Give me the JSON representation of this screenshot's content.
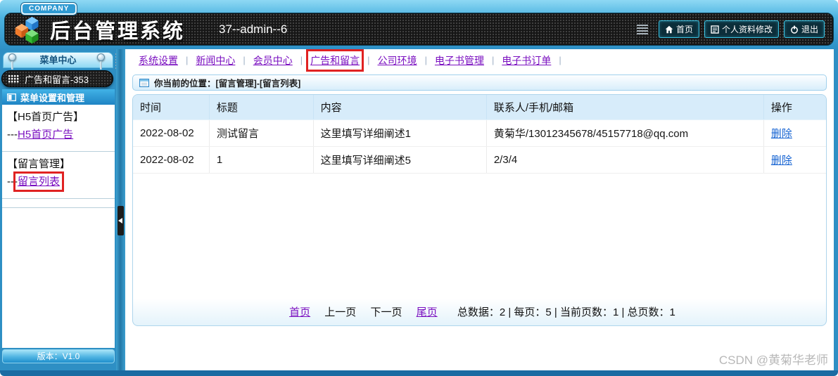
{
  "header": {
    "company_badge": "COMPANY",
    "app_title": "后台管理系统",
    "session_info": "37--admin--6",
    "nav_buttons": [
      {
        "label": "首页"
      },
      {
        "label": "个人资料修改"
      },
      {
        "label": "退出"
      }
    ]
  },
  "sidebar": {
    "menu_center_title": "菜单中心",
    "module_pill_label": "广告和留言-353",
    "section_title": "菜单设置和管理",
    "groups": [
      {
        "heading": "【H5首页广告】",
        "link_prefix": "---",
        "link_label": "H5首页广告"
      },
      {
        "heading": "【留言管理】",
        "link_prefix": "---",
        "link_label": "留言列表"
      }
    ],
    "version_label": "版本：V1.0"
  },
  "topnav": {
    "separator": "|",
    "items": [
      {
        "label": "系统设置"
      },
      {
        "label": "新闻中心"
      },
      {
        "label": "会员中心"
      },
      {
        "label": "广告和留言"
      },
      {
        "label": "公司环境"
      },
      {
        "label": "电子书管理"
      },
      {
        "label": "电子书订单"
      }
    ]
  },
  "breadcrumb": {
    "text": "你当前的位置：[留言管理]-[留言列表]"
  },
  "table": {
    "columns": [
      "时间",
      "标题",
      "内容",
      "联系人/手机/邮箱",
      "操作"
    ],
    "rows": [
      {
        "time": "2022-08-02",
        "title": "测试留言",
        "content": "这里填写详细阐述1",
        "contact": "黄菊华/13012345678/45157718@qq.com",
        "action": "删除"
      },
      {
        "time": "2022-08-02",
        "title": "1",
        "content": "这里填写详细阐述5",
        "contact": "2/3/4",
        "action": "删除"
      }
    ]
  },
  "pagination": {
    "first": "首页",
    "prev": "上一页",
    "next": "下一页",
    "last": "尾页",
    "summary": "总数据：2 | 每页：5 | 当前页数：1 | 总页数：1"
  },
  "watermark": "CSDN @黄菊华老师",
  "colors": {
    "accent_blue": "#2e8fc4",
    "highlight_red": "#e02222",
    "link_purple": "#7a0fc0",
    "link_blue": "#1563d2",
    "header_dark": "#161616"
  }
}
